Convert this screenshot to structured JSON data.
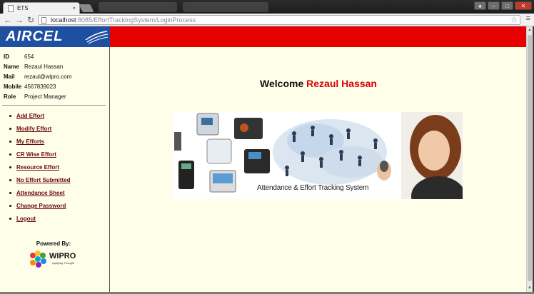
{
  "browser": {
    "tab_title": "ETS",
    "tab_close": "×",
    "url_host": "localhost",
    "url_path": ":8085/EffortTrackingSystem/LoginProcess",
    "back_icon": "arrow-left",
    "forward_icon": "arrow-right",
    "reload_icon": "reload",
    "star_icon": "star",
    "menu_icon": "hamburger"
  },
  "brand": {
    "logo_text": "AIRCEL",
    "banner_color": "#e60000",
    "logo_bg": "#1f4fa0"
  },
  "profile": [
    {
      "label": "ID",
      "value": "654"
    },
    {
      "label": "Name",
      "value": "Rezaul Hassan"
    },
    {
      "label": "Mail",
      "value": "rezaul@wipro.com"
    },
    {
      "label": "Mobile",
      "value": "4567839023"
    },
    {
      "label": "Role",
      "value": "Project Manager"
    }
  ],
  "menu": [
    "Add Effort",
    "Modify Effort",
    "My Efforts",
    "CR Wise Effort",
    "Resource Effort",
    "No Effort Submitted",
    "Attendance Sheet",
    "Change Password",
    "Logout"
  ],
  "footer": {
    "powered_by": "Powered By:",
    "company": "WIPRO",
    "tagline": "Applying Thought"
  },
  "welcome": {
    "prefix": "Welcome",
    "user": "Rezaul Hassan"
  },
  "banner": {
    "caption": "Attendance & Effort Tracking System"
  }
}
